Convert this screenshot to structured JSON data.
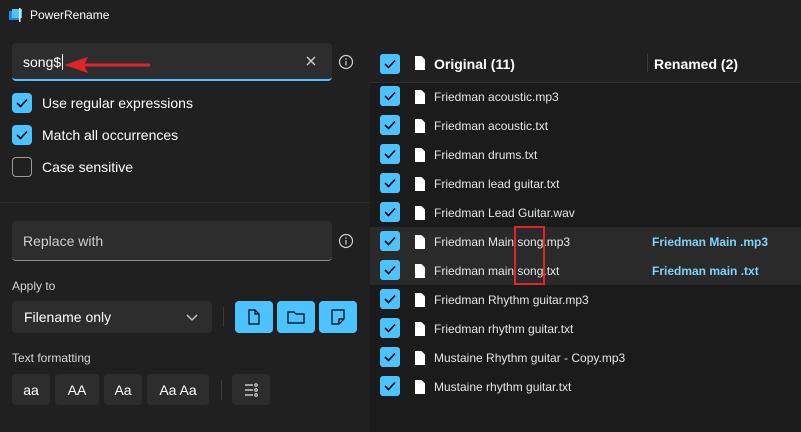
{
  "app": {
    "title": "PowerRename"
  },
  "search": {
    "value": "song$"
  },
  "options": [
    {
      "label": "Use regular expressions",
      "checked": true
    },
    {
      "label": "Match all occurrences",
      "checked": true
    },
    {
      "label": "Case sensitive",
      "checked": false
    }
  ],
  "replace": {
    "placeholder": "Replace with"
  },
  "apply_to": {
    "label": "Apply to",
    "selected": "Filename only"
  },
  "text_formatting": {
    "label": "Text formatting",
    "buttons": [
      "aa",
      "AA",
      "Aa",
      "Aa Aa"
    ]
  },
  "table": {
    "original_header": "Original (11)",
    "renamed_header": "Renamed (2)",
    "rows": [
      {
        "original": "Friedman acoustic.mp3",
        "renamed": ""
      },
      {
        "original": "Friedman acoustic.txt",
        "renamed": ""
      },
      {
        "original": "Friedman drums.txt",
        "renamed": ""
      },
      {
        "original": "Friedman lead guitar.txt",
        "renamed": ""
      },
      {
        "original": "Friedman Lead Guitar.wav",
        "renamed": ""
      },
      {
        "original": "Friedman Main song.mp3",
        "renamed": "Friedman Main .mp3"
      },
      {
        "original": "Friedman main song.txt",
        "renamed": "Friedman main .txt"
      },
      {
        "original": "Friedman Rhythm guitar.mp3",
        "renamed": ""
      },
      {
        "original": "Friedman rhythm guitar.txt",
        "renamed": ""
      },
      {
        "original": "Mustaine Rhythm guitar - Copy.mp3",
        "renamed": ""
      },
      {
        "original": "Mustaine rhythm guitar.txt",
        "renamed": ""
      }
    ]
  },
  "colors": {
    "accent": "#4cc2ff",
    "renamed_text": "#7fd3f7",
    "annotation": "#e0242a"
  }
}
